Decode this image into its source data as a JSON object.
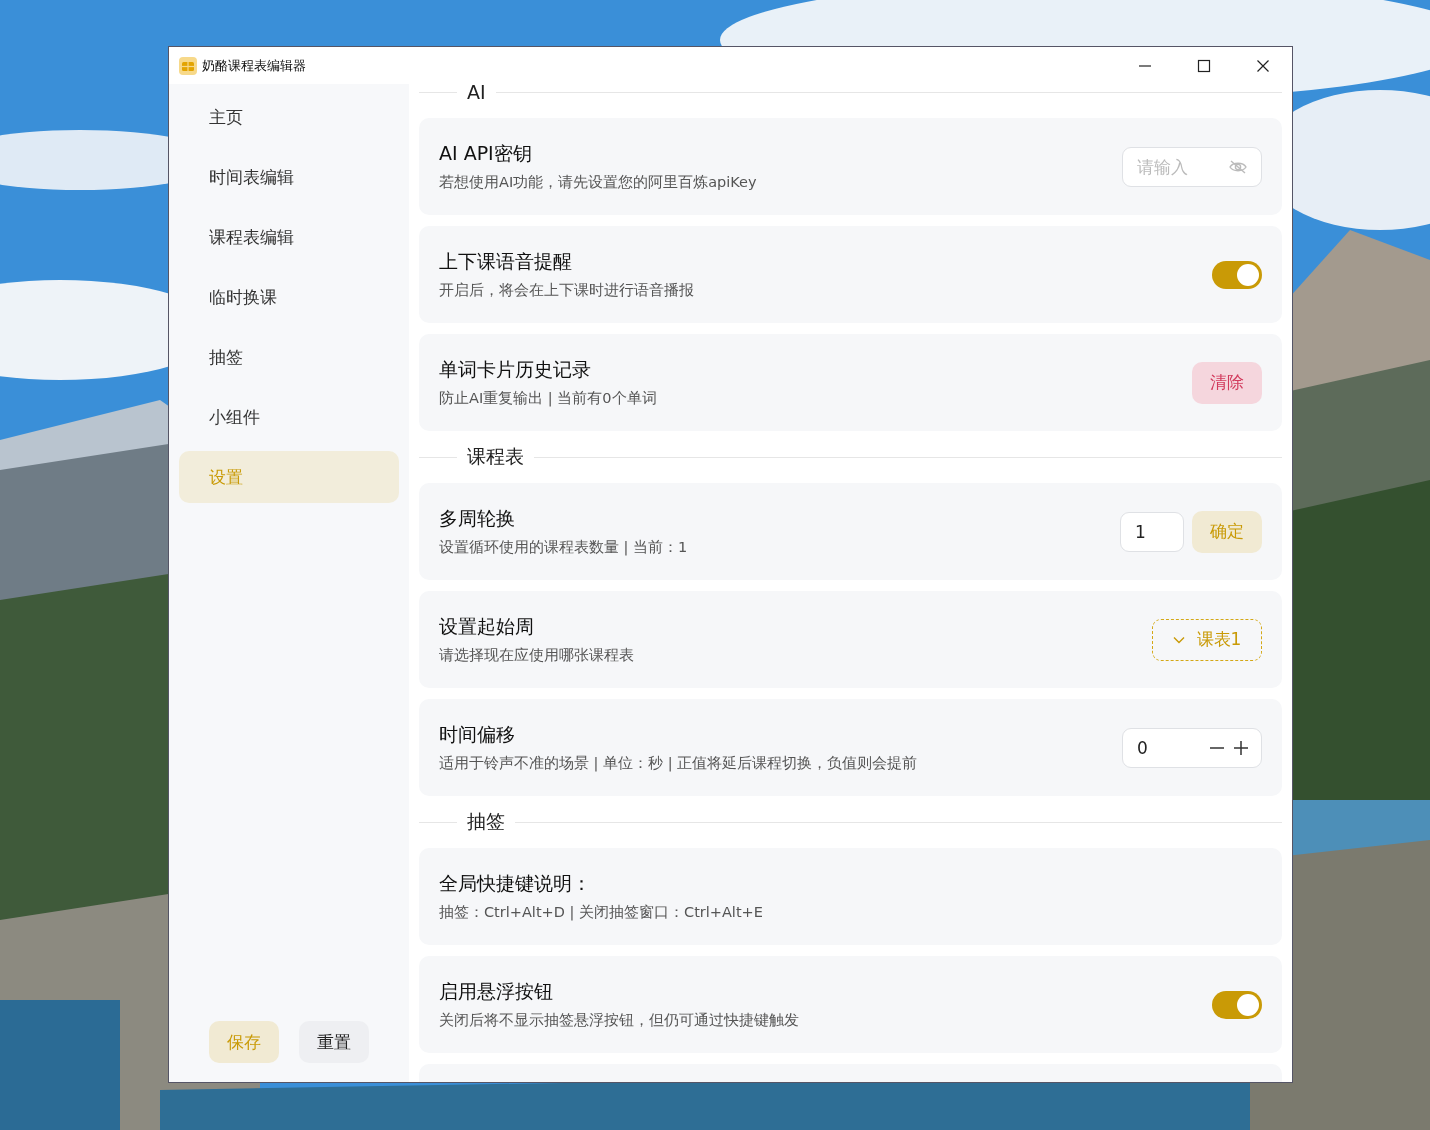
{
  "window": {
    "title": "奶酪课程表编辑器"
  },
  "sidebar": {
    "items": [
      {
        "label": "主页",
        "selected": false
      },
      {
        "label": "时间表编辑",
        "selected": false
      },
      {
        "label": "课程表编辑",
        "selected": false
      },
      {
        "label": "临时换课",
        "selected": false
      },
      {
        "label": "抽签",
        "selected": false
      },
      {
        "label": "小组件",
        "selected": false
      },
      {
        "label": "设置",
        "selected": true
      }
    ],
    "buttons": [
      {
        "label": "保存",
        "kind": "primary"
      },
      {
        "label": "重置",
        "kind": "default"
      }
    ]
  },
  "sections": [
    {
      "title": "AI",
      "rows": [
        {
          "kind": "password",
          "title": "AI API密钥",
          "description": "若想使用AI功能，请先设置您的阿里百炼apiKey",
          "placeholder": "请输入"
        },
        {
          "kind": "toggle",
          "title": "上下课语音提醒",
          "description": "开启后，将会在上下课时进行语音播报",
          "on": true
        },
        {
          "kind": "danger",
          "title": "单词卡片历史记录",
          "description": "防止AI重复输出 | 当前有0个单词",
          "button": "清除"
        }
      ]
    },
    {
      "title": "课程表",
      "rows": [
        {
          "kind": "number",
          "title": "多周轮换",
          "description": "设置循环使用的课程表数量 | 当前：1",
          "value": "1",
          "button": "确定"
        },
        {
          "kind": "select",
          "title": "设置起始周",
          "description": "请选择现在应使用哪张课程表",
          "value": "课表1"
        },
        {
          "kind": "stepper",
          "title": "时间偏移",
          "description": "适用于铃声不准的场景 | 单位：秒 | 正值将延后课程切换，负值则会提前",
          "value": "0"
        }
      ]
    },
    {
      "title": "抽签",
      "rows": [
        {
          "kind": "text",
          "title": "全局快捷键说明：",
          "description": "抽签：Ctrl+Alt+D | 关闭抽签窗口：Ctrl+Alt+E"
        },
        {
          "kind": "toggle",
          "title": "启用悬浮按钮",
          "description": "关闭后将不显示抽签悬浮按钮，但仍可通过快捷键触发",
          "on": true
        }
      ]
    }
  ]
}
